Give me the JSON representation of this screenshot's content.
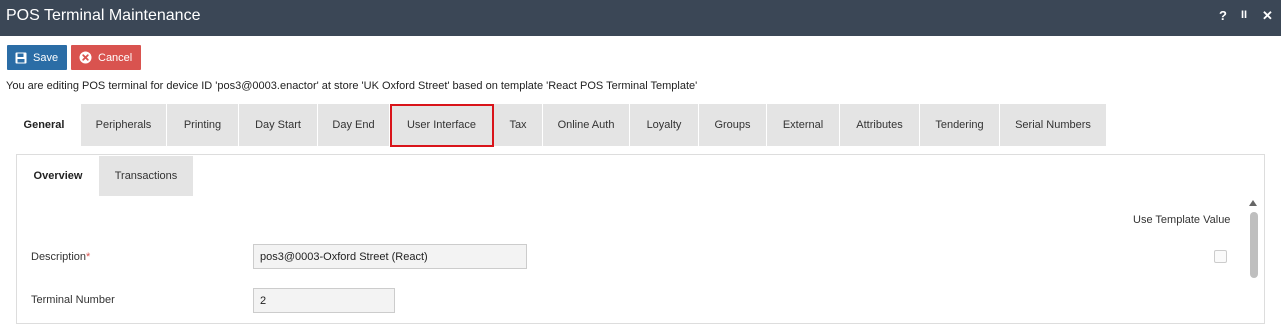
{
  "window": {
    "title": "POS Terminal Maintenance",
    "help_glyph": "?",
    "pause_glyph": "II",
    "close_glyph": "✕"
  },
  "toolbar": {
    "save_label": "Save",
    "cancel_label": "Cancel"
  },
  "info_text": "You are editing POS terminal for device ID 'pos3@0003.enactor' at store 'UK Oxford Street' based on template 'React POS Terminal Template'",
  "tabs": [
    {
      "label": "General",
      "active": true
    },
    {
      "label": "Peripherals"
    },
    {
      "label": "Printing"
    },
    {
      "label": "Day Start"
    },
    {
      "label": "Day End"
    },
    {
      "label": "User Interface",
      "highlighted": true
    },
    {
      "label": "Tax"
    },
    {
      "label": "Online Auth"
    },
    {
      "label": "Loyalty"
    },
    {
      "label": "Groups"
    },
    {
      "label": "External"
    },
    {
      "label": "Attributes"
    },
    {
      "label": "Tendering"
    },
    {
      "label": "Serial Numbers"
    }
  ],
  "subtabs": [
    {
      "label": "Overview",
      "active": true
    },
    {
      "label": "Transactions"
    }
  ],
  "form": {
    "use_template_value_label": "Use Template Value",
    "description": {
      "label": "Description",
      "required_mark": "*",
      "value": "pos3@0003-Oxford Street (React)"
    },
    "terminal_number": {
      "label": "Terminal Number",
      "value": "2"
    }
  },
  "colors": {
    "titlebar": "#3b4756",
    "save": "#2b6da6",
    "cancel": "#d9534f",
    "highlight": "#d9141a"
  }
}
